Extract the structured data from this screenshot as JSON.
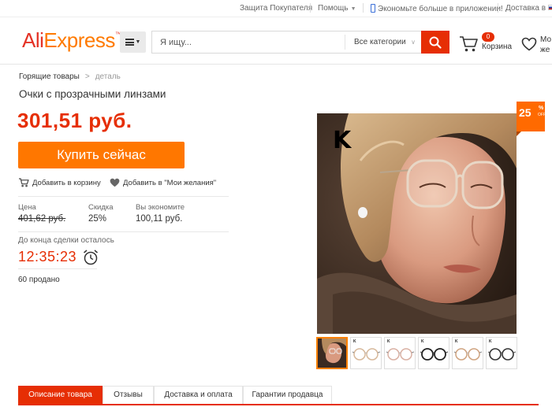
{
  "topbar": {
    "buyer_protection": "Защита Покупателя",
    "help": "Помощь",
    "app_promo": "Экономьте больше в приложении!",
    "delivery": "Доставка в"
  },
  "header": {
    "logo_part1": "Ali",
    "logo_part2": "Express",
    "search_placeholder": "Я ищу...",
    "categories_label": "Все категории",
    "cart_count": "0",
    "cart_label": "Корзина",
    "wishlist_label": "Мо\nже"
  },
  "breadcrumb": {
    "root": "Горящие товары",
    "separator": ">",
    "current": "деталь"
  },
  "product": {
    "title": "Очки с прозрачными линзами",
    "price": "301,51 руб.",
    "buy_now": "Купить сейчас",
    "add_to_cart": "Добавить в корзину",
    "add_to_wishlist": "Добавить в \"Мои желания\"",
    "stats": {
      "price_label": "Цена",
      "price_value": "401,62 руб.",
      "discount_label": "Скидка",
      "discount_value": "25%",
      "saving_label": "Вы экономите",
      "saving_value": "100,11 руб."
    },
    "deal_label": "До конца сделки осталось",
    "timer": "12:35:23",
    "sold": "60 продано",
    "discount_badge": {
      "value": "25",
      "percent": "%",
      "off": "OFF"
    },
    "image_brand_mark": "K",
    "thumbnail_count": 6
  },
  "tabs": [
    {
      "label": "Описание товара",
      "active": true
    },
    {
      "label": "Отзывы",
      "active": false
    },
    {
      "label": "Доставка и оплата",
      "active": false
    },
    {
      "label": "Гарантии продавца",
      "active": false
    }
  ],
  "colors": {
    "accent_red": "#e62e04",
    "buy_orange": "#ff7700",
    "badge_orange": "#ff6a00"
  }
}
